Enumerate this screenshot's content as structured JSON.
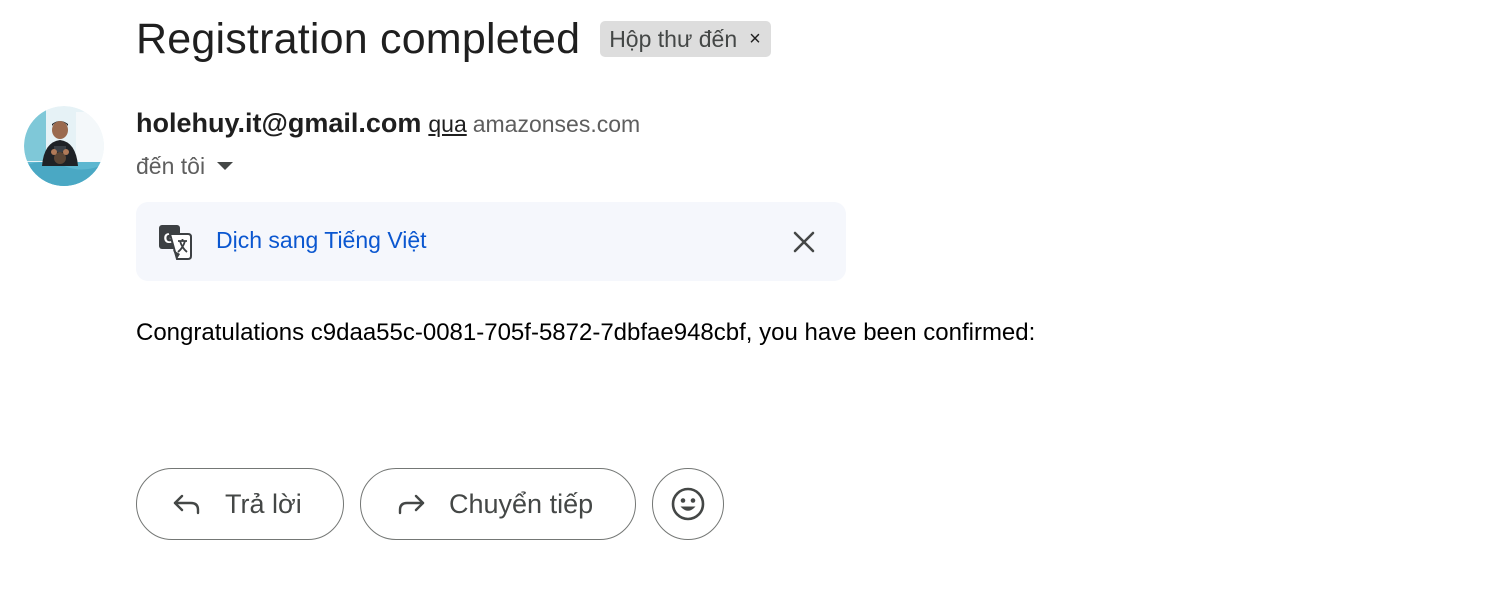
{
  "email": {
    "subject": "Registration completed",
    "label_chip": {
      "text": "Hộp thư đến",
      "remove_glyph": "×"
    },
    "sender": {
      "name": "holehuy.it@gmail.com",
      "via_text": "qua",
      "via_domain": "amazonses.com",
      "avatar_icon": "profile-photo"
    },
    "recipient": {
      "text": "đến tôi",
      "caret_icon": "caret-down-icon"
    },
    "translate_bar": {
      "link_text": "Dịch sang Tiếng Việt",
      "icon": "google-translate-icon",
      "close_icon": "close-icon"
    },
    "body_text": "Congratulations c9daa55c-0081-705f-5872-7dbfae948cbf, you have been confirmed:",
    "actions": {
      "reply_label": "Trả lời",
      "forward_label": "Chuyển tiếp",
      "emoji_icon": "smiley-icon"
    }
  },
  "colors": {
    "link_blue": "#0b57d0",
    "chip_bg": "#dddddd",
    "translate_bg": "#f5f7fc",
    "button_border": "#747775",
    "muted_text": "#5e5e5e"
  }
}
